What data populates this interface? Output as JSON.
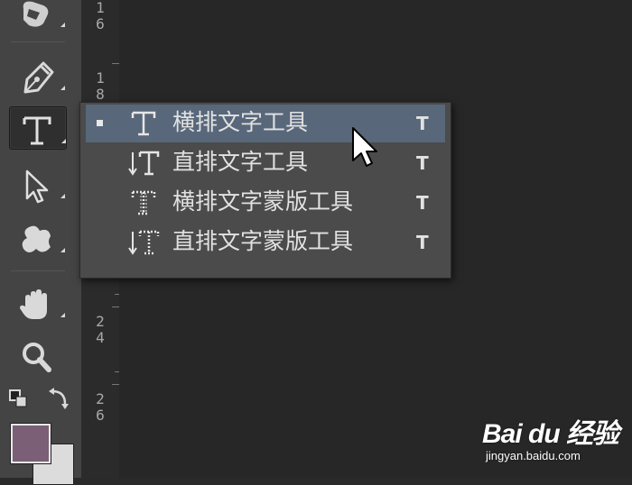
{
  "toolbar": {
    "tools": [
      {
        "name": "stamp-tool",
        "icon": "stamp-icon"
      },
      {
        "name": "pen-tool",
        "icon": "pen-icon"
      },
      {
        "name": "type-tool",
        "icon": "type-icon",
        "active": true
      },
      {
        "name": "path-selection-tool",
        "icon": "arrow-icon"
      },
      {
        "name": "custom-shape-tool",
        "icon": "shape-icon"
      },
      {
        "name": "hand-tool",
        "icon": "hand-icon"
      },
      {
        "name": "zoom-tool",
        "icon": "magnifier-icon"
      }
    ],
    "foreground_color": "#7b5f76",
    "background_color": "#dcdcdc"
  },
  "ruler": {
    "labels": [
      {
        "text": "1\n6"
      },
      {
        "text": "1\n8"
      },
      {
        "text": "2\n4"
      },
      {
        "text": "2\n6"
      }
    ]
  },
  "flyout": {
    "items": [
      {
        "label": "横排文字工具",
        "shortcut": "T",
        "icon": "horizontal-type-icon",
        "selected": true
      },
      {
        "label": "直排文字工具",
        "shortcut": "T",
        "icon": "vertical-type-icon",
        "selected": false
      },
      {
        "label": "横排文字蒙版工具",
        "shortcut": "T",
        "icon": "horizontal-type-mask-icon",
        "selected": false
      },
      {
        "label": "直排文字蒙版工具",
        "shortcut": "T",
        "icon": "vertical-type-mask-icon",
        "selected": false
      }
    ]
  },
  "watermark": {
    "logo_text": "Bai du 经验",
    "url": "jingyan.baidu.com"
  },
  "colors": {
    "panel_bg": "#444444",
    "canvas_bg": "#272727",
    "flyout_bg": "#4b4b4b",
    "selected_bg": "#58677a"
  }
}
